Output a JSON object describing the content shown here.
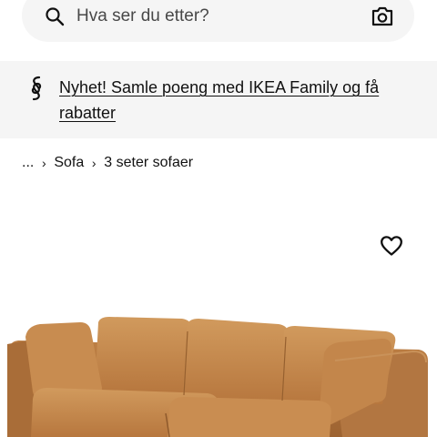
{
  "search": {
    "placeholder": "Hva ser du etter?",
    "search_icon": "search-icon",
    "camera_icon": "camera-icon"
  },
  "promo": {
    "icon": "family-card-icon",
    "text": "Nyhet! Samle poeng med IKEA Family og få rabatter"
  },
  "breadcrumb": {
    "items": [
      "...",
      "Sofa",
      "3 seter sofaer"
    ],
    "separator": "›"
  },
  "product": {
    "favorite_icon": "heart-icon",
    "image": "leather-sofa-photo",
    "image_color": "#c1874b"
  }
}
